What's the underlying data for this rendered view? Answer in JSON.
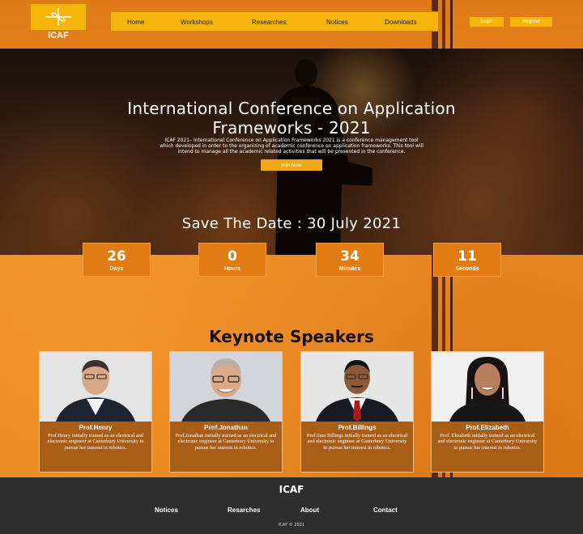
{
  "header": {
    "logo_text": "ICAF",
    "nav": [
      "Home",
      "Workshops",
      "Researches",
      "Notices",
      "Downloads"
    ],
    "login_label": "Login",
    "register_label": "Register"
  },
  "hero": {
    "title_line1": "International Conference on Application",
    "title_line2": "Frameworks - 2021",
    "description_line1": "ICAF 2021– International Conference on Application Frameworks 2021 is a conference management tool",
    "description_line2": "which developed in order to the organizing of academic conference on application frameworks. This tool will",
    "description_line3": "intend to manage all the academic related activities that will be presented in the conference.",
    "join_label": "Join Now",
    "save_date": "Save The Date : 30 July 2021"
  },
  "countdown": [
    {
      "value": "26",
      "label": "Days"
    },
    {
      "value": "0",
      "label": "Hours"
    },
    {
      "value": "34",
      "label": "Minutes"
    },
    {
      "value": "11",
      "label": "Seconds"
    }
  ],
  "keynote": {
    "title": "Keynote Speakers",
    "speakers": [
      {
        "name": "Prof.Henry",
        "desc": "Prof.Henry initially trained as an electrical and electronic engineer at Canterbury University to pursue her interest in robotics."
      },
      {
        "name": "Prof.Jonathan",
        "desc": "Prof.Jonathan initially trained as an electrical and electronic engineer at Canterbury University to pursue her interest in robotics."
      },
      {
        "name": "Prof.Billings",
        "desc": "Prof.Sam Billings initially trained as an electrical and electronic engineer at Canterbury University to pursue her interest in robotics."
      },
      {
        "name": "Prof.Elizabeth",
        "desc": "Prof. Elizabeth initially trained as an electrical and electronic engineer at Canterbury University to pursue her interest in robotics."
      }
    ]
  },
  "footer": {
    "title": "ICAF",
    "links": [
      "Notices",
      "Resarches",
      "About",
      "Contact"
    ],
    "copyright": "ICAF © 2021"
  },
  "colors": {
    "accent": "#f5b50a",
    "background": "#e8861c",
    "footer": "#2e2e2e",
    "card_info": "#a95e18"
  }
}
